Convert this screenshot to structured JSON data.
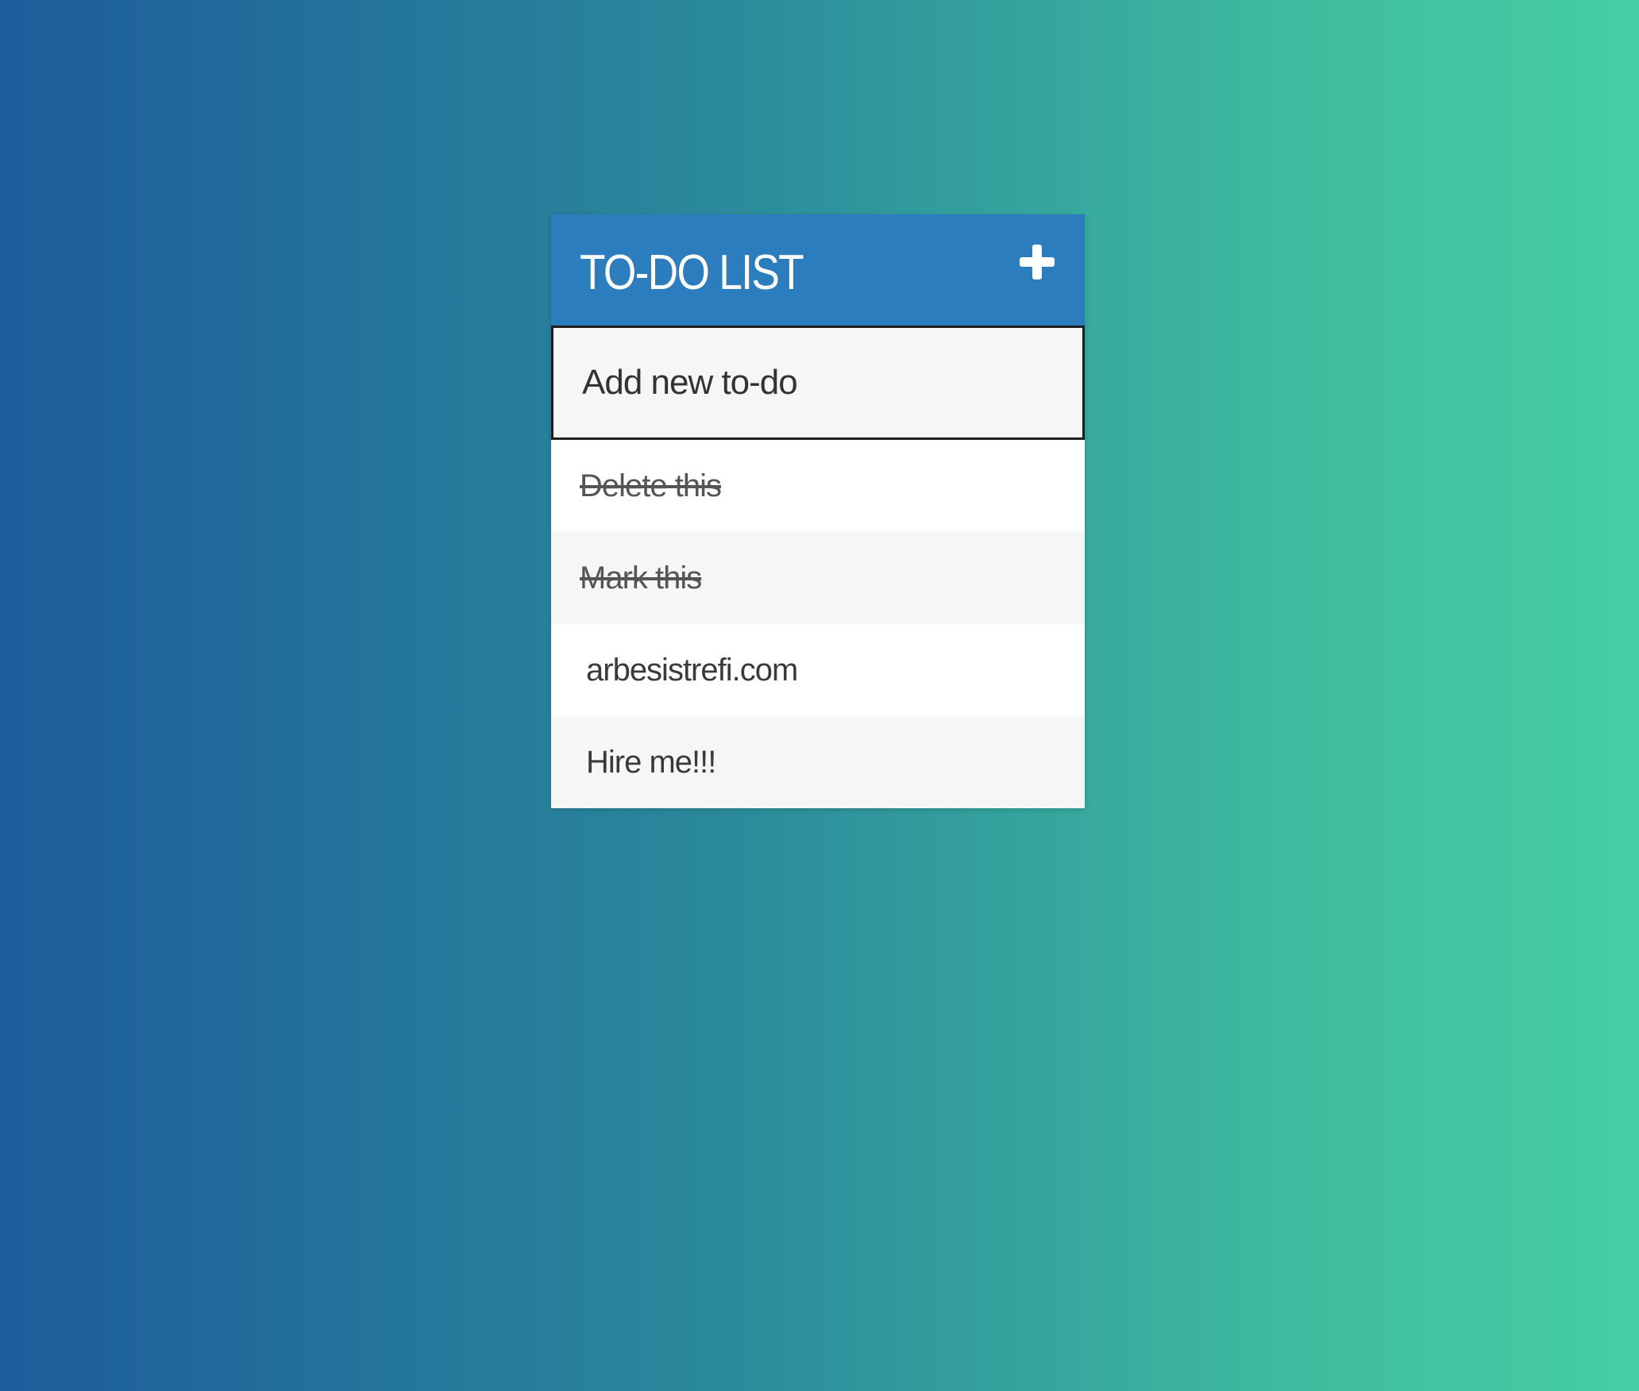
{
  "header": {
    "title": "TO-DO LIST",
    "add_icon": "plus-icon"
  },
  "input": {
    "placeholder": "Add new to-do",
    "value": ""
  },
  "todos": [
    {
      "text": "Delete this",
      "completed": true
    },
    {
      "text": "Mark this",
      "completed": true
    },
    {
      "text": "arbesistrefi.com",
      "completed": false
    },
    {
      "text": "Hire me!!!",
      "completed": false
    }
  ],
  "colors": {
    "header_bg": "#2b7dbd",
    "gradient_start": "#1d5c9b",
    "gradient_end": "#46cea4"
  }
}
